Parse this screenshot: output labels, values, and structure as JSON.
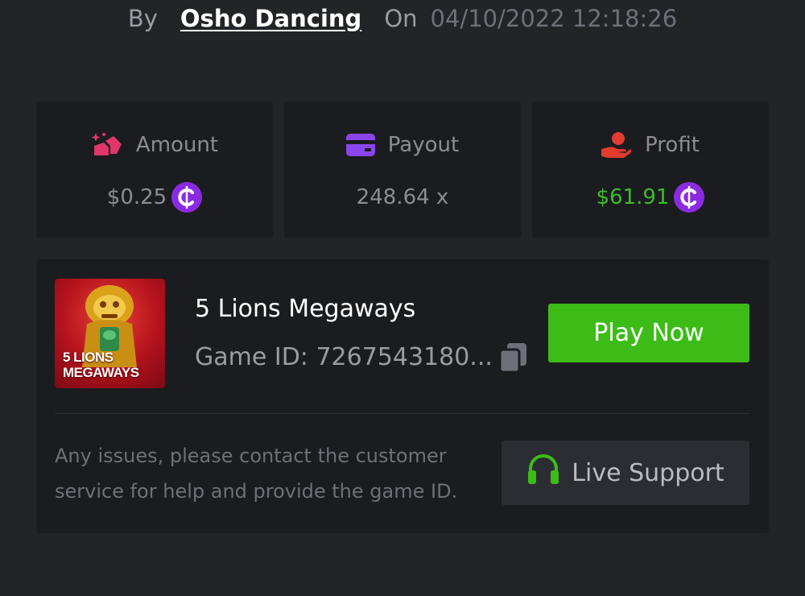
{
  "byline": {
    "by": "By",
    "user": "Osho Dancing",
    "on": "On",
    "datetime": "04/10/2022 12:18:26"
  },
  "stats": [
    {
      "label": "Amount",
      "value": "$0.25",
      "icon": "amount-icon",
      "coin": true,
      "color": "#e0366a"
    },
    {
      "label": "Payout",
      "value": "248.64 x",
      "icon": "credit-card-icon",
      "coin": false,
      "color": "#8b45f0"
    },
    {
      "label": "Profit",
      "value": "$61.91",
      "icon": "hand-profit-icon",
      "coin": true,
      "color": "#e23b30",
      "value_color": "#3dbc2b"
    }
  ],
  "game": {
    "title": "5 Lions Megaways",
    "id_text": "Game ID: 7267543180...",
    "thumb_line1": "5 LIONS",
    "thumb_line2": "MEGAWAYS",
    "play_label": "Play Now"
  },
  "help": {
    "text": "Any issues, please contact the customer service for help and provide the game ID.",
    "support_label": "Live Support"
  },
  "colors": {
    "background": "#232428",
    "card": "#1b1c1f",
    "accent_green": "#3dbc18",
    "coin_purple": "#8a2be2"
  }
}
